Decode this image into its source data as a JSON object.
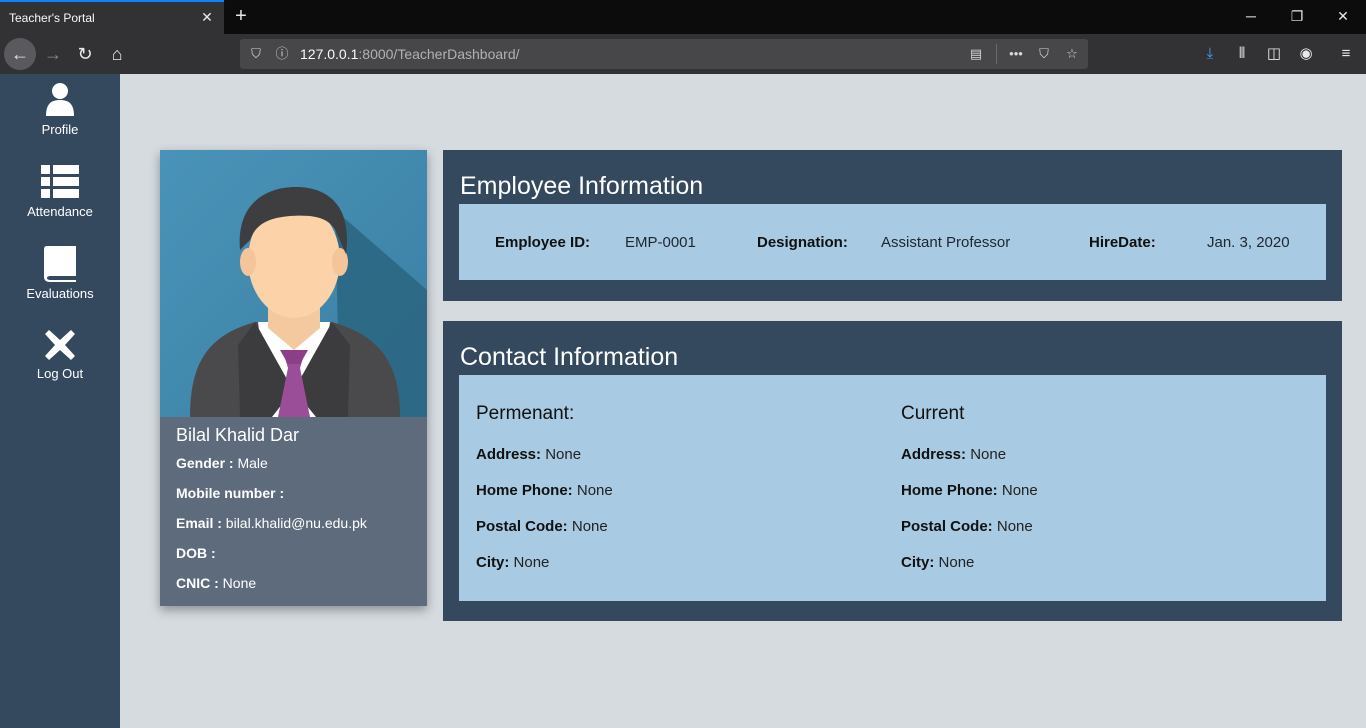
{
  "browser": {
    "tab_title": "Teacher's Portal",
    "url_host": "127.0.0.1",
    "url_path": ":8000/TeacherDashboard/"
  },
  "sidebar": {
    "items": [
      {
        "label": "Profile",
        "icon": "user-icon"
      },
      {
        "label": "Attendance",
        "icon": "list-icon"
      },
      {
        "label": "Evaluations",
        "icon": "book-icon"
      },
      {
        "label": "Log Out",
        "icon": "close-icon"
      }
    ]
  },
  "profile": {
    "name": "Bilal Khalid Dar",
    "gender_label": "Gender :",
    "gender": "Male",
    "mobile_label": "Mobile number :",
    "mobile": "",
    "email_label": "Email :",
    "email": "bilal.khalid@nu.edu.pk",
    "dob_label": "DOB :",
    "dob": "",
    "cnic_label": "CNIC :",
    "cnic": "None"
  },
  "employee": {
    "title": "Employee Information",
    "id_label": "Employee ID:",
    "id": "EMP-0001",
    "designation_label": "Designation:",
    "designation": "Assistant Professor",
    "hire_label": "HireDate:",
    "hire_date": "Jan. 3, 2020"
  },
  "contact": {
    "title": "Contact Information",
    "permanent": {
      "heading": "Permenant:",
      "address_label": "Address:",
      "address": "None",
      "phone_label": "Home Phone:",
      "phone": "None",
      "postal_label": "Postal Code:",
      "postal": "None",
      "city_label": "City:",
      "city": "None"
    },
    "current": {
      "heading": "Current",
      "address_label": "Address:",
      "address": "None",
      "phone_label": "Home Phone:",
      "phone": "None",
      "postal_label": "Postal Code:",
      "postal": "None",
      "city_label": "City:",
      "city": "None"
    }
  },
  "colors": {
    "sidebar": "#34495e",
    "panel": "#34495e",
    "panel_body": "#a8cae2",
    "card": "#5e6b7c",
    "background": "#d6dbe0"
  }
}
